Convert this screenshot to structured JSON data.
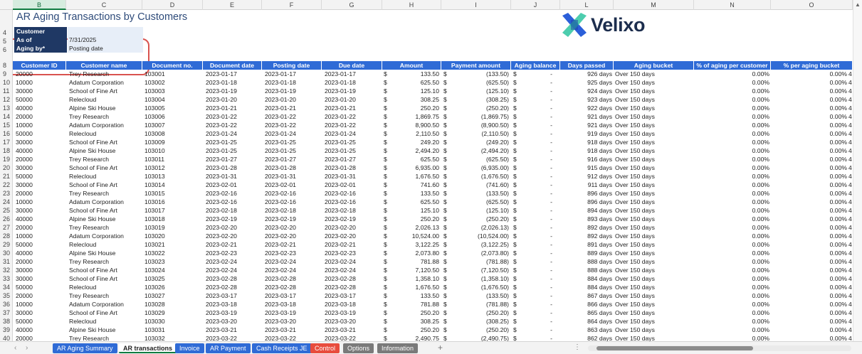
{
  "columns": [
    "B",
    "C",
    "D",
    "E",
    "F",
    "G",
    "H",
    "I",
    "J",
    "L",
    "M",
    "N",
    "O"
  ],
  "title": "AR Aging Transactions by Customers",
  "params": [
    {
      "row": "4",
      "label": "Customer",
      "value": ""
    },
    {
      "row": "5",
      "label": "As of",
      "value": "7/31/2025"
    },
    {
      "row": "6",
      "label": "Aging by*",
      "value": "Posting date"
    }
  ],
  "logo": {
    "brand": "Velixo"
  },
  "header_row": "8",
  "headers": [
    "Customer ID",
    "Customer name",
    "Document no.",
    "Document date",
    "Posting date",
    "Due date",
    "Amount",
    "Payment amount",
    "Aging balance",
    "Days passed",
    "Aging bucket",
    "% of aging per customer",
    "% per aging bucket"
  ],
  "rows": [
    [
      "9",
      "20000",
      "Trey Research",
      "103001",
      "2023-01-17",
      "2023-01-17",
      "2023-01-17",
      "133.50",
      "(133.50)",
      "926 days",
      "Over 150 days",
      "0.00%",
      "0.00%"
    ],
    [
      "10",
      "10000",
      "Adatum Corporation",
      "103002",
      "2023-01-18",
      "2023-01-18",
      "2023-01-18",
      "625.50",
      "(625.50)",
      "925 days",
      "Over 150 days",
      "0.00%",
      "0.00%"
    ],
    [
      "11",
      "30000",
      "School of Fine Art",
      "103003",
      "2023-01-19",
      "2023-01-19",
      "2023-01-19",
      "125.10",
      "(125.10)",
      "924 days",
      "Over 150 days",
      "0.00%",
      "0.00%"
    ],
    [
      "12",
      "50000",
      "Relecloud",
      "103004",
      "2023-01-20",
      "2023-01-20",
      "2023-01-20",
      "308.25",
      "(308.25)",
      "923 days",
      "Over 150 days",
      "0.00%",
      "0.00%"
    ],
    [
      "13",
      "40000",
      "Alpine Ski House",
      "103005",
      "2023-01-21",
      "2023-01-21",
      "2023-01-21",
      "250.20",
      "(250.20)",
      "922 days",
      "Over 150 days",
      "0.00%",
      "0.00%"
    ],
    [
      "14",
      "20000",
      "Trey Research",
      "103006",
      "2023-01-22",
      "2023-01-22",
      "2023-01-22",
      "1,869.75",
      "(1,869.75)",
      "921 days",
      "Over 150 days",
      "0.00%",
      "0.00%"
    ],
    [
      "15",
      "10000",
      "Adatum Corporation",
      "103007",
      "2023-01-22",
      "2023-01-22",
      "2023-01-22",
      "8,900.50",
      "(8,900.50)",
      "921 days",
      "Over 150 days",
      "0.00%",
      "0.00%"
    ],
    [
      "16",
      "50000",
      "Relecloud",
      "103008",
      "2023-01-24",
      "2023-01-24",
      "2023-01-24",
      "2,110.50",
      "(2,110.50)",
      "919 days",
      "Over 150 days",
      "0.00%",
      "0.00%"
    ],
    [
      "17",
      "30000",
      "School of Fine Art",
      "103009",
      "2023-01-25",
      "2023-01-25",
      "2023-01-25",
      "249.20",
      "(249.20)",
      "918 days",
      "Over 150 days",
      "0.00%",
      "0.00%"
    ],
    [
      "18",
      "40000",
      "Alpine Ski House",
      "103010",
      "2023-01-25",
      "2023-01-25",
      "2023-01-25",
      "2,494.20",
      "(2,494.20)",
      "918 days",
      "Over 150 days",
      "0.00%",
      "0.00%"
    ],
    [
      "19",
      "20000",
      "Trey Research",
      "103011",
      "2023-01-27",
      "2023-01-27",
      "2023-01-27",
      "625.50",
      "(625.50)",
      "916 days",
      "Over 150 days",
      "0.00%",
      "0.00%"
    ],
    [
      "20",
      "30000",
      "School of Fine Art",
      "103012",
      "2023-01-28",
      "2023-01-28",
      "2023-01-28",
      "6,935.00",
      "(6,935.00)",
      "915 days",
      "Over 150 days",
      "0.00%",
      "0.00%"
    ],
    [
      "21",
      "50000",
      "Relecloud",
      "103013",
      "2023-01-31",
      "2023-01-31",
      "2023-01-31",
      "1,676.50",
      "(1,676.50)",
      "912 days",
      "Over 150 days",
      "0.00%",
      "0.00%"
    ],
    [
      "22",
      "30000",
      "School of Fine Art",
      "103014",
      "2023-02-01",
      "2023-02-01",
      "2023-02-01",
      "741.60",
      "(741.60)",
      "911 days",
      "Over 150 days",
      "0.00%",
      "0.00%"
    ],
    [
      "23",
      "20000",
      "Trey Research",
      "103015",
      "2023-02-16",
      "2023-02-16",
      "2023-02-16",
      "133.50",
      "(133.50)",
      "896 days",
      "Over 150 days",
      "0.00%",
      "0.00%"
    ],
    [
      "24",
      "10000",
      "Adatum Corporation",
      "103016",
      "2023-02-16",
      "2023-02-16",
      "2023-02-16",
      "625.50",
      "(625.50)",
      "896 days",
      "Over 150 days",
      "0.00%",
      "0.00%"
    ],
    [
      "25",
      "30000",
      "School of Fine Art",
      "103017",
      "2023-02-18",
      "2023-02-18",
      "2023-02-18",
      "125.10",
      "(125.10)",
      "894 days",
      "Over 150 days",
      "0.00%",
      "0.00%"
    ],
    [
      "26",
      "40000",
      "Alpine Ski House",
      "103018",
      "2023-02-19",
      "2023-02-19",
      "2023-02-19",
      "250.20",
      "(250.20)",
      "893 days",
      "Over 150 days",
      "0.00%",
      "0.00%"
    ],
    [
      "27",
      "20000",
      "Trey Research",
      "103019",
      "2023-02-20",
      "2023-02-20",
      "2023-02-20",
      "2,026.13",
      "(2,026.13)",
      "892 days",
      "Over 150 days",
      "0.00%",
      "0.00%"
    ],
    [
      "28",
      "10000",
      "Adatum Corporation",
      "103020",
      "2023-02-20",
      "2023-02-20",
      "2023-02-20",
      "10,524.00",
      "(10,524.00)",
      "892 days",
      "Over 150 days",
      "0.00%",
      "0.00%"
    ],
    [
      "29",
      "50000",
      "Relecloud",
      "103021",
      "2023-02-21",
      "2023-02-21",
      "2023-02-21",
      "3,122.25",
      "(3,122.25)",
      "891 days",
      "Over 150 days",
      "0.00%",
      "0.00%"
    ],
    [
      "30",
      "40000",
      "Alpine Ski House",
      "103022",
      "2023-02-23",
      "2023-02-23",
      "2023-02-23",
      "2,073.80",
      "(2,073.80)",
      "889 days",
      "Over 150 days",
      "0.00%",
      "0.00%"
    ],
    [
      "31",
      "20000",
      "Trey Research",
      "103023",
      "2023-02-24",
      "2023-02-24",
      "2023-02-24",
      "781.88",
      "(781.88)",
      "888 days",
      "Over 150 days",
      "0.00%",
      "0.00%"
    ],
    [
      "32",
      "30000",
      "School of Fine Art",
      "103024",
      "2023-02-24",
      "2023-02-24",
      "2023-02-24",
      "7,120.50",
      "(7,120.50)",
      "888 days",
      "Over 150 days",
      "0.00%",
      "0.00%"
    ],
    [
      "33",
      "30000",
      "School of Fine Art",
      "103025",
      "2023-02-28",
      "2023-02-28",
      "2023-02-28",
      "1,358.10",
      "(1,358.10)",
      "884 days",
      "Over 150 days",
      "0.00%",
      "0.00%"
    ],
    [
      "34",
      "50000",
      "Relecloud",
      "103026",
      "2023-02-28",
      "2023-02-28",
      "2023-02-28",
      "1,676.50",
      "(1,676.50)",
      "884 days",
      "Over 150 days",
      "0.00%",
      "0.00%"
    ],
    [
      "35",
      "20000",
      "Trey Research",
      "103027",
      "2023-03-17",
      "2023-03-17",
      "2023-03-17",
      "133.50",
      "(133.50)",
      "867 days",
      "Over 150 days",
      "0.00%",
      "0.00%"
    ],
    [
      "36",
      "10000",
      "Adatum Corporation",
      "103028",
      "2023-03-18",
      "2023-03-18",
      "2023-03-18",
      "781.88",
      "(781.88)",
      "866 days",
      "Over 150 days",
      "0.00%",
      "0.00%"
    ],
    [
      "37",
      "30000",
      "School of Fine Art",
      "103029",
      "2023-03-19",
      "2023-03-19",
      "2023-03-19",
      "250.20",
      "(250.20)",
      "865 days",
      "Over 150 days",
      "0.00%",
      "0.00%"
    ],
    [
      "38",
      "50000",
      "Relecloud",
      "103030",
      "2023-03-20",
      "2023-03-20",
      "2023-03-20",
      "308.25",
      "(308.25)",
      "864 days",
      "Over 150 days",
      "0.00%",
      "0.00%"
    ],
    [
      "39",
      "40000",
      "Alpine Ski House",
      "103031",
      "2023-03-21",
      "2023-03-21",
      "2023-03-21",
      "250.20",
      "(250.20)",
      "863 days",
      "Over 150 days",
      "0.00%",
      "0.00%"
    ],
    [
      "40",
      "20000",
      "Trey Research",
      "103032",
      "2023-03-22",
      "2023-03-22",
      "2023-03-22",
      "2,490.75",
      "(2,490.75)",
      "862 days",
      "Over 150 days",
      "0.00%",
      "0.00%"
    ]
  ],
  "currency_symbol": "$",
  "zero_dash": "-",
  "pct_suffix": "4",
  "tabs": [
    {
      "label": "AR Aging Summary",
      "style": "blue"
    },
    {
      "label": "AR transactions",
      "style": "active"
    },
    {
      "label": "Invoice",
      "style": "blue"
    },
    {
      "label": "AR Payment",
      "style": "blue"
    },
    {
      "label": "Cash Receipts JE",
      "style": "blue"
    },
    {
      "label": "Control",
      "style": "red"
    },
    {
      "label": "Options",
      "style": "gray"
    },
    {
      "label": "Information",
      "style": "gray"
    }
  ],
  "nav": {
    "prev": "‹",
    "next": "›",
    "add": "+",
    "more": "⋮"
  },
  "colors": {
    "header_blue": "#2f6bd6",
    "param_navy": "#1f3864",
    "highlight_red": "#d9534f",
    "logo_blue": "#2b5fd9",
    "logo_green": "#2ec4a0"
  }
}
